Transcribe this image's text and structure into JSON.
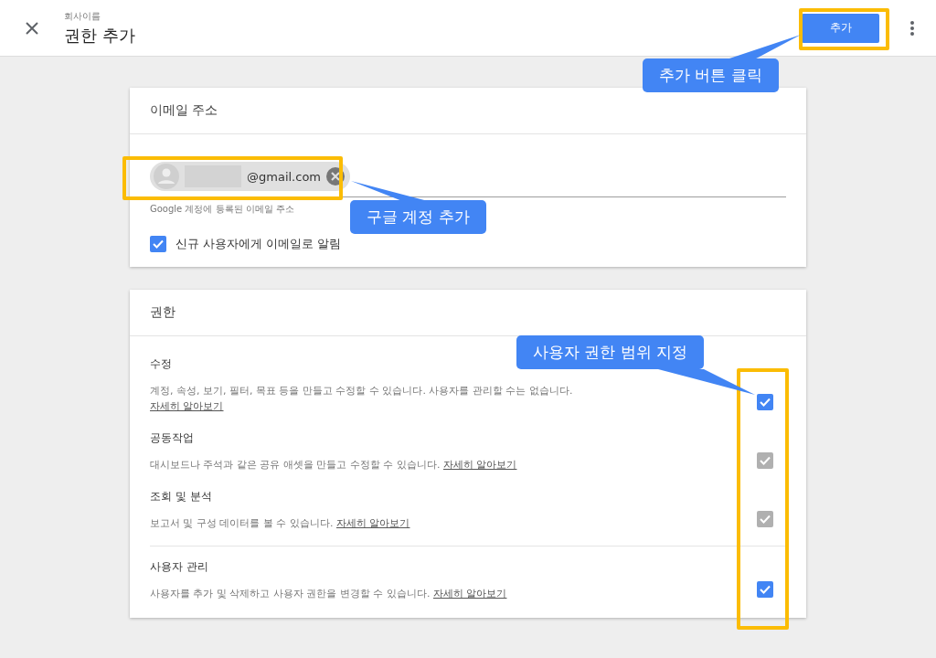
{
  "header": {
    "subtitle": "회사이름",
    "title": "권한 추가",
    "add_button": "추가"
  },
  "email_card": {
    "title": "이메일 주소",
    "chip": {
      "email": "@gmail.com"
    },
    "hint": "Google 계정에 등록된 이메일 주소",
    "notify": {
      "label": "신규 사용자에게 이메일로 알림",
      "checked": true
    }
  },
  "permissions_card": {
    "title": "권한",
    "items": [
      {
        "name": "수정",
        "description": "계정, 속성, 보기, 필터, 목표 등을 만들고 수정할 수 있습니다. 사용자를 관리할 수는 없습니다.",
        "link": "자세히 알아보기",
        "checked": true,
        "disabled": false,
        "divider_before": false
      },
      {
        "name": "공동작업",
        "description": "대시보드나 주석과 같은 공유 애셋을 만들고 수정할 수 있습니다.",
        "link": "자세히 알아보기",
        "checked": true,
        "disabled": true,
        "divider_before": false
      },
      {
        "name": "조회 및 분석",
        "description": "보고서 및 구성 데이터를 볼 수 있습니다.",
        "link": "자세히 알아보기",
        "checked": true,
        "disabled": true,
        "divider_before": false
      },
      {
        "name": "사용자 관리",
        "description": "사용자를 추가 및 삭제하고 사용자 권한을 변경할 수 있습니다.",
        "link": "자세히 알아보기",
        "checked": true,
        "disabled": false,
        "divider_before": true
      }
    ]
  },
  "annotations": [
    {
      "text": "추가 버튼 클릭"
    },
    {
      "text": "구글 계정 추가"
    },
    {
      "text": "사용자 권한 범위 지정"
    }
  ]
}
